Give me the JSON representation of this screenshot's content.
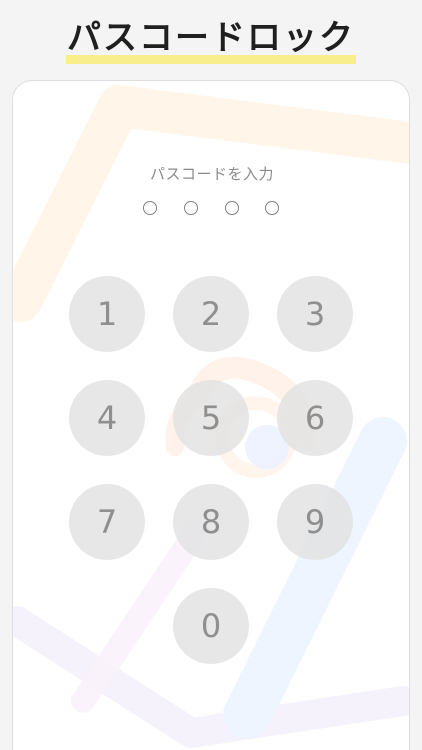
{
  "header": {
    "title": "パスコードロック"
  },
  "passcode": {
    "prompt": "パスコードを入力",
    "digits_entered": 0,
    "digits_total": 4
  },
  "keypad": {
    "keys": [
      "1",
      "2",
      "3",
      "4",
      "5",
      "6",
      "7",
      "8",
      "9",
      "0"
    ]
  },
  "colors": {
    "background": "#f4f4f4",
    "highlight": "#f8ef8c",
    "key_background": "#e2e2e2",
    "key_text": "#8f8f8f",
    "prompt_text": "#8b8b8b",
    "headline_text": "#1f1f1f"
  }
}
